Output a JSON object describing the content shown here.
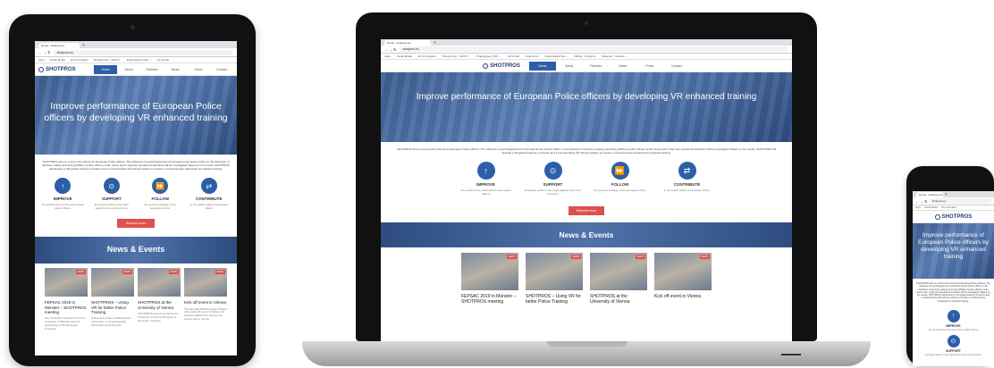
{
  "browser": {
    "tab_title": "Home - shotpros.eu",
    "new_tab": "+",
    "url": "shotpros.eu",
    "nav_icons": "← → ↻",
    "bookmarks": [
      "Apps",
      "Social Media",
      "EU Information",
      "Shotpros EU - SHOTI...",
      "Projectgroep (VR) -...",
      "UU Portal",
      "Uniprocure",
      "Social Media Tem...",
      "NRCid - OneDrive",
      "Webmail :: Welcom..."
    ]
  },
  "site": {
    "logo": "SHOTPROS",
    "menu": [
      "Home",
      "About",
      "Partners",
      "News",
      "Press",
      "Contact"
    ],
    "hero_title": "Improve performance of European Police officers by developing VR enhanced training",
    "intro": "SHOTPROS aims to improve the training for European Police officers. The influence of psychological and contextual human factors (HFs) on the behaviour of decision-making and acting (DMA) of police officers under stress and in high-risk operational situations will be investigated. Based on the results, SHOTPROS will develop a VR-guided training curriculum and a corresponding VR training solution to provide a comprehensive framework for practical training.",
    "features": [
      {
        "icon": "↑",
        "title": "IMPROVE",
        "desc": "the performance of European street patrol officers"
      },
      {
        "icon": "⊙",
        "title": "SUPPORT",
        "desc": "European police in their fight against crime and terrorism"
      },
      {
        "icon": "⏩",
        "title": "FOLLOW",
        "desc": "the security strategy of the European Union"
      },
      {
        "icon": "⇄",
        "title": "CONTRIBUTE",
        "desc": "to the public safety of European citizen"
      }
    ],
    "discover_button": "Discover more",
    "news_heading": "News & Events",
    "news_tag": "NEWS",
    "cards": [
      {
        "title": "FEPSAC 2019 in Münster – SHOTPROS meeting",
        "desc": "Our consortium members from the University of Münster took the opportunity of the European Congress"
      },
      {
        "title": "SHOTPROS – Using VR for better Police Training",
        "desc": "A European wide multidisciplinary consortium, a comprehensive framework combining VR"
      },
      {
        "title": "SHOTPROS at the University of Vienna",
        "desc": "SHOTPROS was presented at the University of Vienna. Because of European research"
      },
      {
        "title": "Kick off event in Vienna",
        "desc": "The EU SHOTPROS project started with a kick-off event in Vienna. All partners gathered to discuss the project and to set the"
      }
    ]
  }
}
